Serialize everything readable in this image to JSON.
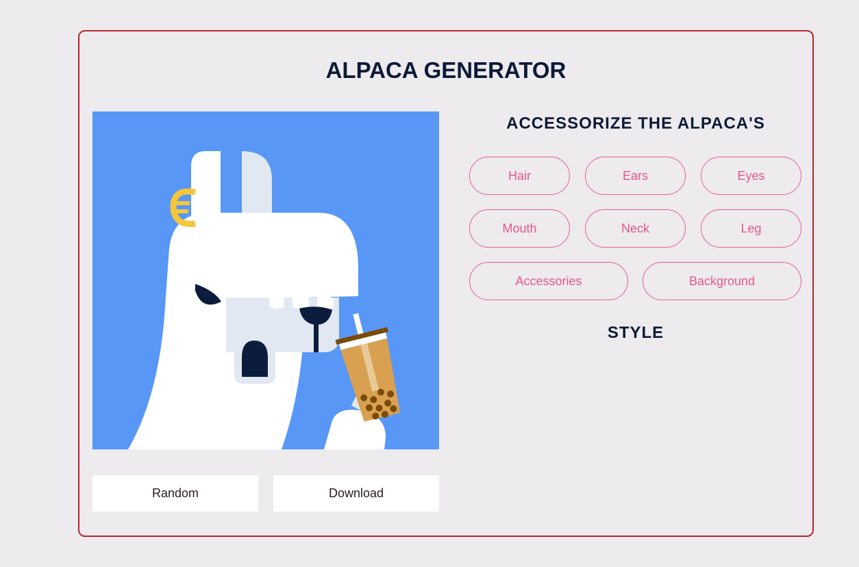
{
  "app": {
    "title": "ALPACA GENERATOR"
  },
  "preview": {
    "background_color": "#5897f6",
    "accessory_icon": "bubble-tea-icon",
    "earring_icon": "euro-earring-icon"
  },
  "actions": {
    "random_label": "Random",
    "download_label": "Download"
  },
  "accessorize": {
    "heading": "ACCESSORIZE THE ALPACA'S",
    "options": [
      {
        "label": "Hair"
      },
      {
        "label": "Ears"
      },
      {
        "label": "Eyes"
      },
      {
        "label": "Mouth"
      },
      {
        "label": "Neck"
      },
      {
        "label": "Leg"
      },
      {
        "label": "Accessories"
      },
      {
        "label": "Background"
      }
    ]
  },
  "style": {
    "heading": "STYLE"
  },
  "colors": {
    "border": "#b5272c",
    "accent": "#e5588a",
    "heading": "#0c1a36",
    "page_bg": "#edebee"
  }
}
